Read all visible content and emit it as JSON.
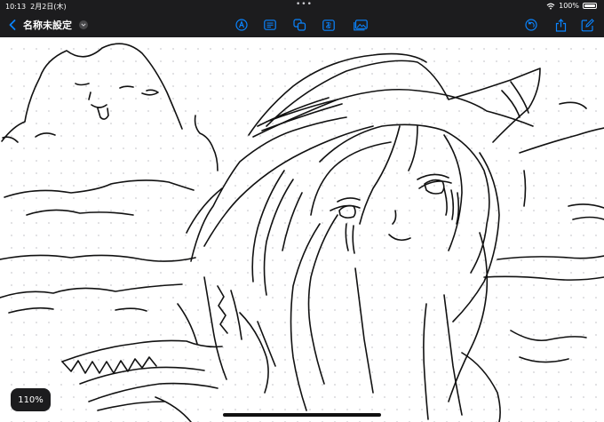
{
  "status_bar": {
    "time": "10:13",
    "date": "2月2日(木)",
    "multitask_dots": "•••",
    "battery_percent": "100%"
  },
  "toolbar": {
    "document_title": "名称未設定",
    "icons": [
      "back-chevron-icon",
      "title-menu-chevron-icon",
      "markup-pen-icon",
      "text-box-icon",
      "shapes-icon",
      "text-insert-icon",
      "media-icon",
      "undo-icon",
      "share-icon",
      "compose-icon"
    ]
  },
  "canvas": {
    "zoom_label": "110%"
  },
  "colors": {
    "bar": "#1c1c1e",
    "accent": "#0a84ff",
    "ink": "#111111",
    "grid_dot": "#d9d9dc"
  }
}
